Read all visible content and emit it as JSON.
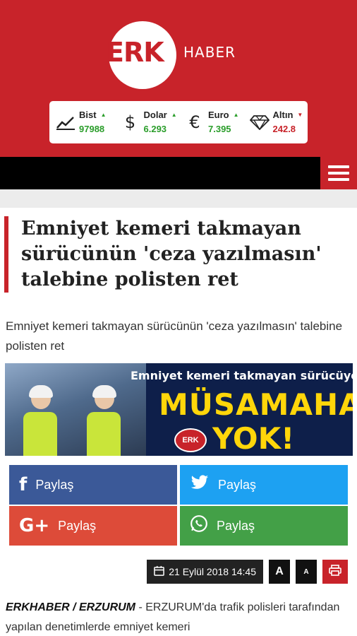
{
  "brand": {
    "logo_main": "ERK",
    "logo_sub": "HABER"
  },
  "ticker": [
    {
      "label": "Bist",
      "value": "97988",
      "trend": "up",
      "icon": "chart-up-icon"
    },
    {
      "label": "Dolar",
      "value": "6.293",
      "trend": "up",
      "icon": "dollar-icon"
    },
    {
      "label": "Euro",
      "value": "7.395",
      "trend": "up",
      "icon": "euro-icon"
    },
    {
      "label": "Altın",
      "value": "242.8",
      "trend": "down",
      "icon": "diamond-icon"
    }
  ],
  "article": {
    "title": "Emniyet kemeri takmayan sürücünün 'ceza yazılmasın' talebine polisten ret",
    "summary": "Emniyet kemeri takmayan sürücünün 'ceza yazılmasın' talebine polisten ret",
    "banner": {
      "line1": "Emniyet kemeri takmayan sürücüye",
      "line2": "MÜSAMAHA",
      "line3": "YOK!",
      "logo": "ERK"
    },
    "date": "21 Eylül 2018 14:45",
    "lead_source": "ERKHABER / ERZURUM",
    "lead_separator": " - ",
    "body_start": "ERZURUM'da trafik polisleri tarafından yapılan denetimlerde emniyet kemeri"
  },
  "share": [
    {
      "network": "facebook",
      "label": "Paylaş",
      "icon": "facebook-icon"
    },
    {
      "network": "twitter",
      "label": "Paylaş",
      "icon": "twitter-icon"
    },
    {
      "network": "google",
      "label": "Paylaş",
      "icon": "google-plus-icon"
    },
    {
      "network": "whatsapp",
      "label": "Paylaş",
      "icon": "whatsapp-icon"
    }
  ],
  "toolbar": {
    "font_large": "A",
    "font_small": "A"
  },
  "colors": {
    "brand_red": "#c8232a",
    "up_green": "#2a9d2a",
    "nav_black": "#000000"
  }
}
